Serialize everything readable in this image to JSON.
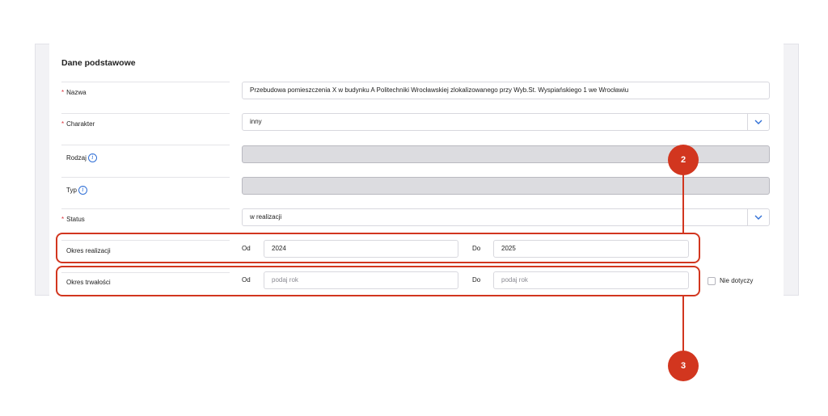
{
  "section": {
    "title": "Dane podstawowe"
  },
  "fields": {
    "nazwa": {
      "label": "Nazwa",
      "required_mark": "*",
      "value": "Przebudowa pomieszczenia X w budynku A Politechniki Wrocławskiej zlokalizowanego przy Wyb.St. Wyspiańskiego 1 we Wrocławiu"
    },
    "charakter": {
      "label": "Charakter",
      "required_mark": "*",
      "value": "inny"
    },
    "rodzaj": {
      "label": "Rodzaj",
      "value": ""
    },
    "typ": {
      "label": "Typ",
      "value": ""
    },
    "status": {
      "label": "Status",
      "required_mark": "*",
      "value": "w realizacji"
    },
    "okres_realizacji": {
      "label": "Okres realizacji",
      "from_label": "Od",
      "from_value": "2024",
      "to_label": "Do",
      "to_value": "2025"
    },
    "okres_trwalosci": {
      "label": "Okres trwałości",
      "from_label": "Od",
      "from_placeholder": "podaj rok",
      "to_label": "Do",
      "to_placeholder": "podaj rok",
      "not_applicable_label": "Nie dotyczy"
    }
  },
  "callouts": {
    "first": "2",
    "second": "3"
  },
  "colors": {
    "accent": "#d2361f",
    "required": "#d9303a",
    "link": "#2f6fd6"
  }
}
